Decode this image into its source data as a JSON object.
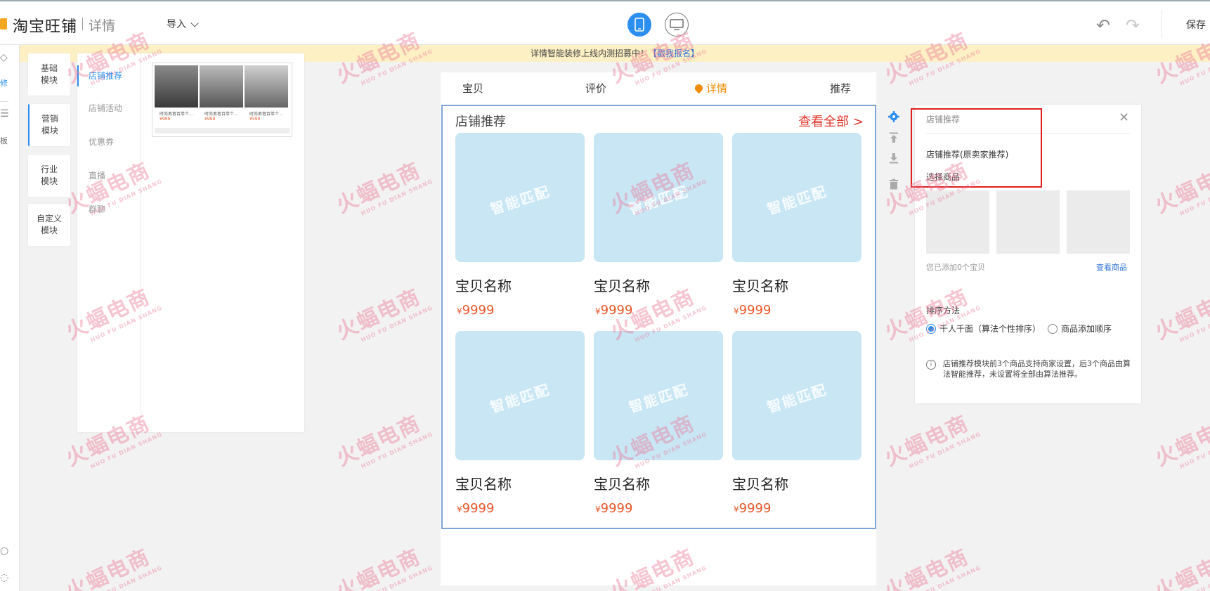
{
  "header": {
    "logo_text": "淘宝旺铺",
    "logo_sub": "详情",
    "import_label": "导入",
    "save_label": "保存"
  },
  "notice": {
    "text": "详情智能装修上线内测招募中！",
    "link": "【戳我报名】"
  },
  "far_left": {
    "items": [
      "修",
      "板"
    ]
  },
  "categories": [
    {
      "label": "基础\n模块"
    },
    {
      "label": "营销\n模块"
    },
    {
      "label": "行业\n模块"
    },
    {
      "label": "自定义\n模块"
    }
  ],
  "sub_nav": [
    "店铺推荐",
    "店铺活动",
    "优惠券",
    "直播",
    "群聊"
  ],
  "thumbnail": {
    "captions": [
      "时尚男者百单个...",
      "时尚男者百单个...",
      "时尚男者百单个..."
    ],
    "prices": [
      "¥999",
      "¥999",
      "¥599"
    ]
  },
  "phone": {
    "tabs": [
      "宝贝",
      "评价",
      "详情",
      "推荐"
    ],
    "module_title": "店铺推荐",
    "view_all": "查看全部 >",
    "image_watermark": "智能匹配",
    "products": [
      {
        "name": "宝贝名称",
        "price": "9999"
      },
      {
        "name": "宝贝名称",
        "price": "9999"
      },
      {
        "name": "宝贝名称",
        "price": "9999"
      },
      {
        "name": "宝贝名称",
        "price": "9999"
      },
      {
        "name": "宝贝名称",
        "price": "9999"
      },
      {
        "name": "宝贝名称",
        "price": "9999"
      }
    ],
    "currency": "¥"
  },
  "settings": {
    "title": "店铺推荐",
    "option_label": "店铺推荐(原卖家推荐)",
    "select_label": "选择商品",
    "added_text": "您已添加0个宝贝",
    "view_products": "查看商品",
    "sort_label": "排序方法",
    "sort_options": [
      "千人千面（算法个性排序）",
      "商品添加顺序"
    ],
    "info": "店铺推荐模块前3个商品支持商家设置，后3个商品由算法智能推荐，未设置将全部由算法推荐。"
  },
  "watermark": {
    "big": "火蝠电商",
    "small": "HUO FU DIAN SHANG"
  },
  "colors": {
    "accent": "#2b8ef0",
    "price": "#e9572b",
    "highlight": "#e02020",
    "active_tab": "#f08c00",
    "placeholder": "#c9e6f4"
  }
}
